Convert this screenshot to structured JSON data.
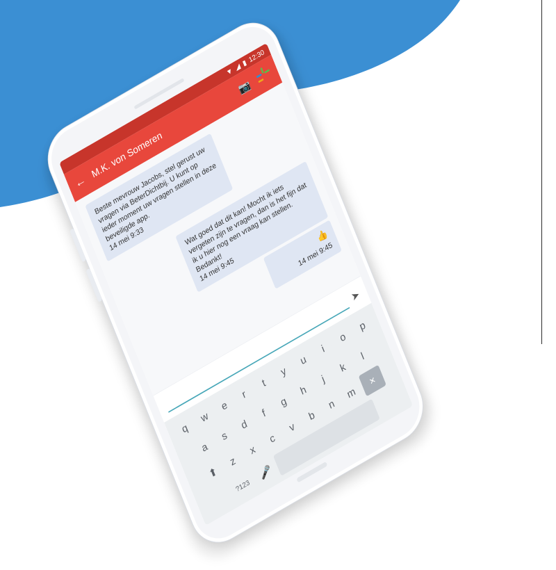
{
  "status_bar": {
    "time": "12:30",
    "icons": [
      "wifi-icon",
      "signal-icon",
      "battery-icon"
    ]
  },
  "app_bar": {
    "back_icon": "←",
    "title": "M.K. von Someren",
    "camera_icon": "📷"
  },
  "messages": [
    {
      "text": "Beste mevrouw Jacobs, stel gerust uw vragen via BeterDichtbij. U kunt op ieder moment uw vragen stellen in deze beveiligde app.",
      "time": "14 mei 9:33",
      "side": "left"
    },
    {
      "text": "Wat goed dat dit kan! Mocht ik iets vergeten zijn te vragen, dan is het fijn dat ik u hier nog een vraag kan stellen. Bedankt!",
      "time": "14 mei 9:45",
      "side": "right"
    },
    {
      "text": "👍",
      "time": "14 mei 9:45",
      "side": "right"
    }
  ],
  "input": {
    "send_icon": "➤"
  },
  "keyboard": {
    "row1": [
      "q",
      "w",
      "e",
      "r",
      "t",
      "y",
      "u",
      "i",
      "o",
      "p"
    ],
    "row2": [
      "a",
      "s",
      "d",
      "f",
      "g",
      "h",
      "j",
      "k",
      "l"
    ],
    "row3": [
      "z",
      "x",
      "c",
      "v",
      "b",
      "n",
      "m"
    ],
    "mode_key": "?123",
    "shift_icon": "⬆",
    "mic_icon": "🎤",
    "delete_icon": "✕"
  },
  "colors": {
    "background_blue": "#3b8fd3",
    "app_red": "#e8473c",
    "bubble": "#dfe6f3"
  }
}
